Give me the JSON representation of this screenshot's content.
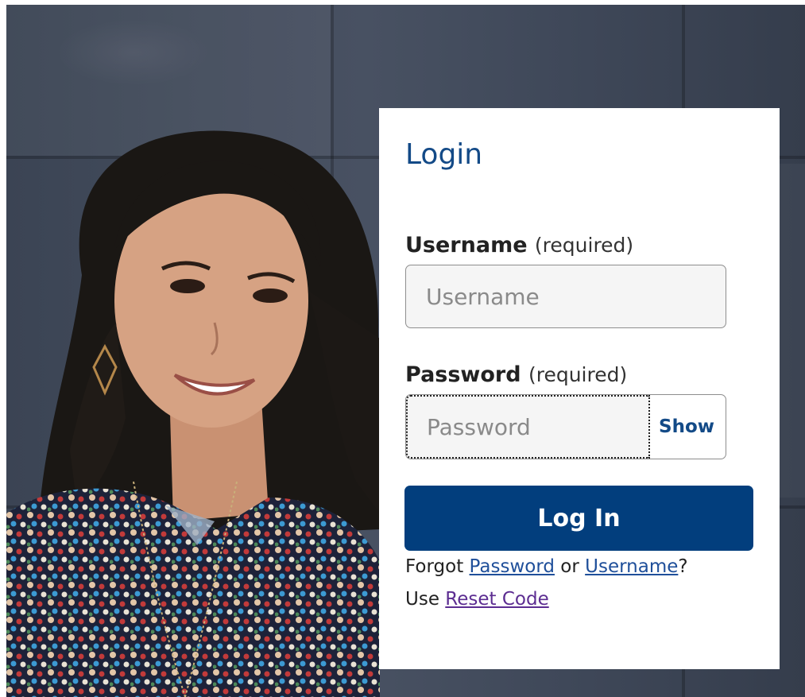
{
  "login": {
    "title": "Login",
    "username": {
      "label": "Username",
      "required": "(required)",
      "placeholder": "Username",
      "value": ""
    },
    "password": {
      "label": "Password",
      "required": "(required)",
      "placeholder": "Password",
      "value": "",
      "show_label": "Show"
    },
    "submit_label": "Log In",
    "forgot": {
      "prefix": "Forgot",
      "password_link": "Password",
      "or": "or",
      "username_link": "Username",
      "suffix": "?"
    },
    "reset": {
      "prefix": "Use",
      "link": "Reset Code"
    }
  },
  "colors": {
    "brand_blue": "#023e7d",
    "title_blue": "#134a87",
    "link_blue": "#1f4f9a",
    "visited_purple": "#5c2d91"
  }
}
